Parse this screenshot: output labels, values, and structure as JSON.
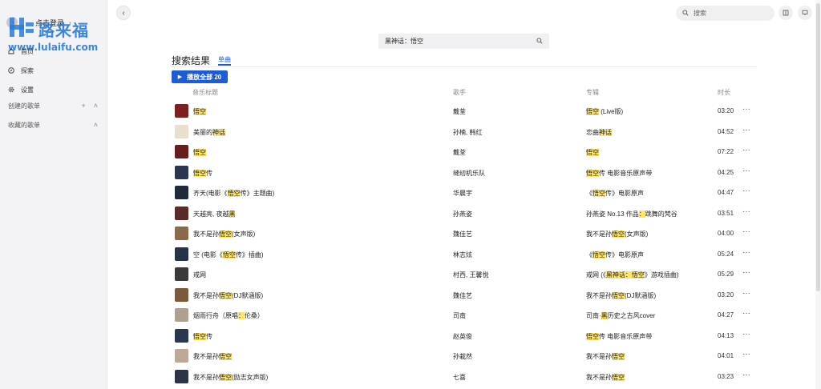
{
  "sidebar": {
    "user_label": "点击登录",
    "watermark_cn": "路来福",
    "watermark_url": "www.lulaifu.com",
    "nav": [
      {
        "label": "首页",
        "icon": "home-icon"
      },
      {
        "label": "探索",
        "icon": "compass-icon"
      },
      {
        "label": "设置",
        "icon": "gear-icon"
      }
    ],
    "created_playlists": "创建的歌单",
    "collected_playlists": "收藏的歌单"
  },
  "topbar": {
    "search_placeholder": "搜索",
    "query": "黑神话：悟空"
  },
  "main": {
    "title": "搜索结果",
    "tab_label": "单曲",
    "play_all_label": "播放全部 20",
    "columns": {
      "title": "音乐标题",
      "artist": "歌手",
      "album": "专辑",
      "duration": "时长"
    }
  },
  "songs": [
    {
      "title": "悟空",
      "title_hl": "悟空",
      "artist": "戴荃",
      "album": "悟空 (Live版)",
      "album_hl": "悟空",
      "duration": "03:20",
      "cover": "#7a2020"
    },
    {
      "title": "美丽的神话",
      "title_hl": "神话",
      "artist": "孙楠, 韩红",
      "album": "恋曲神话",
      "album_hl": "神话",
      "duration": "04:52",
      "cover": "#e8dfd0"
    },
    {
      "title": "悟空",
      "title_hl": "悟空",
      "artist": "戴荃",
      "album": "悟空",
      "album_hl": "悟空",
      "duration": "07:22",
      "cover": "#6a1c1c"
    },
    {
      "title": "悟空传",
      "title_hl": "悟空",
      "artist": "缝纫机乐队",
      "album": "悟空传 电影音乐原声带",
      "album_hl": "悟空",
      "duration": "04:25",
      "cover": "#2a3550"
    },
    {
      "title": "齐天(电影《悟空传》主题曲)",
      "title_hl": "悟空",
      "artist": "华晨宇",
      "album": "《悟空传》电影原声",
      "album_hl": "悟空",
      "duration": "04:47",
      "cover": "#1f2a3d"
    },
    {
      "title": "天越亮, 夜越黑",
      "title_hl": "黑",
      "artist": "孙燕姿",
      "album": "孙燕姿 No.13 作品：跳舞的梵谷",
      "album_hl": "：",
      "duration": "03:51",
      "cover": "#5a2a2a"
    },
    {
      "title": "我不是孙悟空(女声版)",
      "title_hl": "悟空",
      "artist": "魏佳艺",
      "album": "我不是孙悟空(女声版)",
      "album_hl": "悟空",
      "duration": "04:00",
      "cover": "#8a6a4a"
    },
    {
      "title": "空 (电影《悟空传》插曲)",
      "title_hl": "悟空",
      "artist": "林志炫",
      "album": "《悟空传》电影原声",
      "album_hl": "悟空",
      "duration": "05:24",
      "cover": "#253248"
    },
    {
      "title": "戒网",
      "title_hl": "",
      "artist": "村西, 王馨悦",
      "album": "戒网 (《黑神话：悟空》游戏插曲)",
      "album_hl": "黑神话：悟空",
      "duration": "05:29",
      "cover": "#3a3a3a"
    },
    {
      "title": "我不是孙悟空(DJ默涵版)",
      "title_hl": "悟空",
      "artist": "魏佳艺",
      "album": "我不是孙悟空(DJ默涵版)",
      "album_hl": "悟空",
      "duration": "03:20",
      "cover": "#7a5a3a"
    },
    {
      "title": "烟雨行舟（原唱：伦桑）",
      "title_hl": "：",
      "artist": "司南",
      "album": "司南·黑历史之古风cover",
      "album_hl": "黑",
      "duration": "04:27",
      "cover": "#b0a090"
    },
    {
      "title": "悟空传",
      "title_hl": "悟空",
      "artist": "赵英俊",
      "album": "悟空传 电影音乐原声带",
      "album_hl": "悟空",
      "duration": "04:13",
      "cover": "#2a3550"
    },
    {
      "title": "我不是孙悟空",
      "title_hl": "悟空",
      "artist": "孙栽然",
      "album": "我不是孙悟空",
      "album_hl": "悟空",
      "duration": "04:01",
      "cover": "#c0a898"
    },
    {
      "title": "我不是孙悟空(励志女声版)",
      "title_hl": "悟空",
      "artist": "七喜",
      "album": "我不是孙悟空",
      "album_hl": "悟空",
      "duration": "03:23",
      "cover": "#2e3448"
    }
  ],
  "colors": {
    "accent": "#1e5bd6",
    "highlight": "#ffe66b",
    "sidebar_bg": "#f3f3f5"
  }
}
